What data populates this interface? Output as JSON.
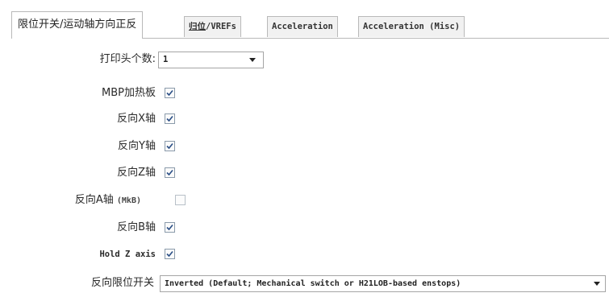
{
  "tabs": [
    {
      "label_a": "限位开关/运动轴方向正反",
      "label_b": "",
      "active": true
    },
    {
      "label_a": "归位",
      "label_b": "/VREFs",
      "active": false
    },
    {
      "label_a": "Acceleration",
      "label_b": "",
      "active": false
    },
    {
      "label_a": "Acceleration (Misc)",
      "label_b": "",
      "active": false
    }
  ],
  "form": {
    "head_count": {
      "label": "打印头个数:",
      "value": "1"
    },
    "mbp_heatbed": {
      "label": "MBP加热板",
      "checked": true
    },
    "invert_x": {
      "label": "反向X轴",
      "checked": true
    },
    "invert_y": {
      "label": "反向Y轴",
      "checked": true
    },
    "invert_z": {
      "label": "反向Z轴",
      "checked": true
    },
    "invert_a": {
      "label": "反向A轴",
      "note": "(MkB)",
      "checked": false
    },
    "invert_b": {
      "label": "反向B轴",
      "checked": true
    },
    "hold_z": {
      "label": "Hold Z axis",
      "checked": true
    },
    "invert_endstops": {
      "label": "反向限位开关",
      "value": "Inverted (Default; Mechanical switch or H21LOB-based enstops)"
    }
  }
}
